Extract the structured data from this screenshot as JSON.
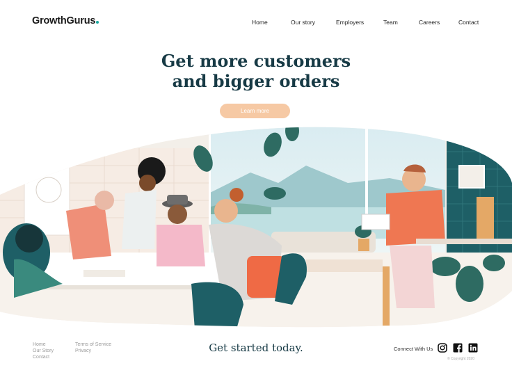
{
  "brand": {
    "name": "GrowthGurus",
    "accent": "#1aa8a0"
  },
  "nav": {
    "items": [
      {
        "label": "Home"
      },
      {
        "label": "Our story"
      },
      {
        "label": "Employers"
      },
      {
        "label": "Team"
      },
      {
        "label": "Careers"
      },
      {
        "label": "Contact"
      }
    ]
  },
  "hero": {
    "title_line1": "Get more customers",
    "title_line2": "and bigger orders",
    "cta_label": "Learn more"
  },
  "footer": {
    "col1": [
      {
        "label": "Home"
      },
      {
        "label": "Our Story"
      },
      {
        "label": "Contact"
      }
    ],
    "col2": [
      {
        "label": "Terms of Service"
      },
      {
        "label": "Privacy"
      }
    ],
    "tagline": "Get started today.",
    "connect_label": "Connect With Us",
    "social_icons": [
      "instagram-icon",
      "facebook-icon",
      "linkedin-icon"
    ],
    "copyright": "© Copyright 2020"
  },
  "colors": {
    "title": "#173a45",
    "cta_bg": "#f6c9a4",
    "teal": "#1e5f66",
    "coral": "#ef7752"
  }
}
